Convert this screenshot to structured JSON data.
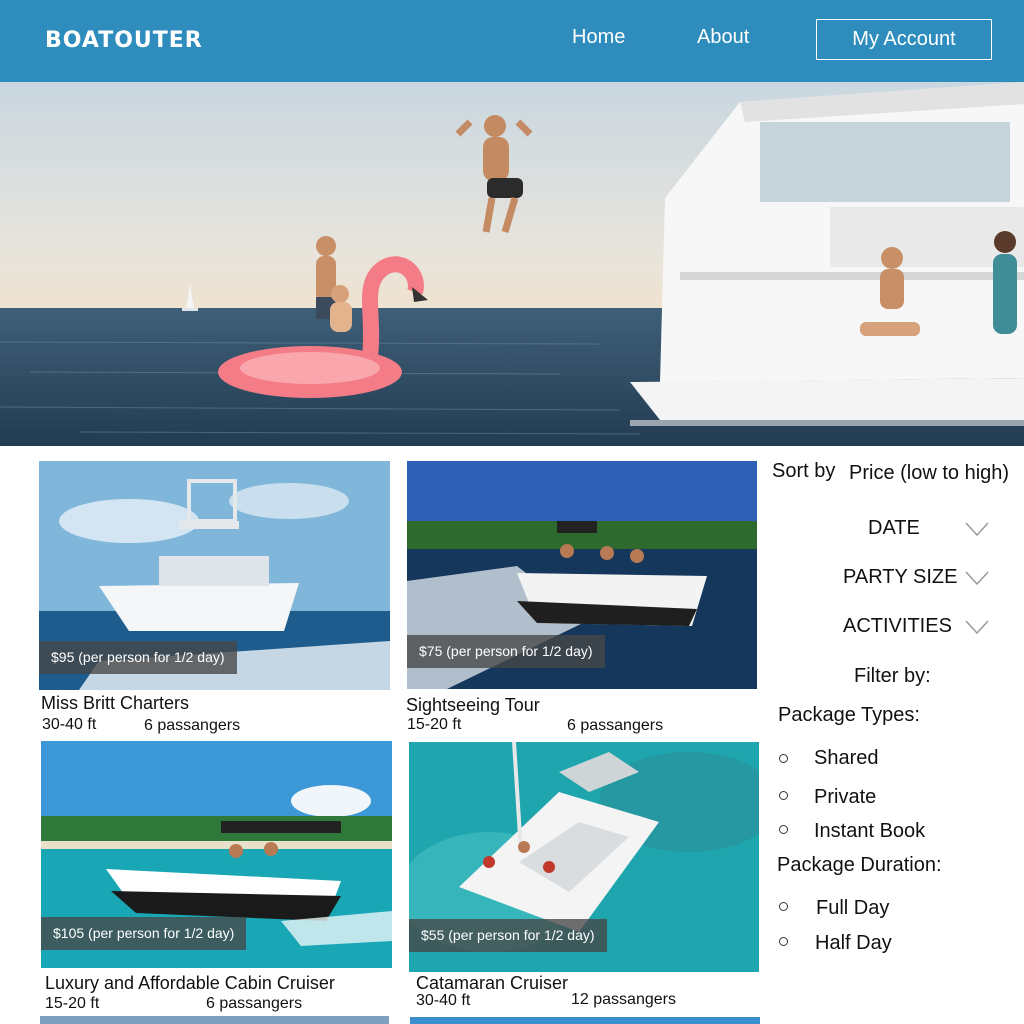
{
  "header": {
    "logo": "BOATOUTER",
    "nav": {
      "home": "Home",
      "about": "About",
      "account": "My Account"
    },
    "background": "#2f8dbd"
  },
  "listings": [
    {
      "price": "$95 (per person for 1/2 day)",
      "title": "Miss Britt Charters",
      "length": "30-40 ft",
      "passengers": "6 passangers"
    },
    {
      "price": "$75 (per person for 1/2 day)",
      "title": "Sightseeing Tour",
      "length": "15-20 ft",
      "passengers": "6 passangers"
    },
    {
      "price": "$105 (per person for 1/2 day)",
      "title": "Luxury and Affordable Cabin Cruiser",
      "length": "15-20 ft",
      "passengers": "6 passangers"
    },
    {
      "price": "$55 (per person for 1/2 day)",
      "title": "Catamaran Cruiser",
      "length": "30-40 ft",
      "passengers": "12 passangers"
    }
  ],
  "sidebar": {
    "sort_label": "Sort by",
    "sort_value": "Price (low to high)",
    "dropdowns": [
      "DATE",
      "PARTY SIZE",
      "ACTIVITIES"
    ],
    "filter_label": "Filter by:",
    "package_types_label": "Package Types:",
    "package_types": [
      "Shared",
      "Private",
      "Instant Book"
    ],
    "package_duration_label": "Package Duration:",
    "package_durations": [
      "Full Day",
      "Half Day"
    ]
  },
  "icons": {
    "dropdown": "chevron-down-icon",
    "radio": "radio-unchecked-icon"
  }
}
